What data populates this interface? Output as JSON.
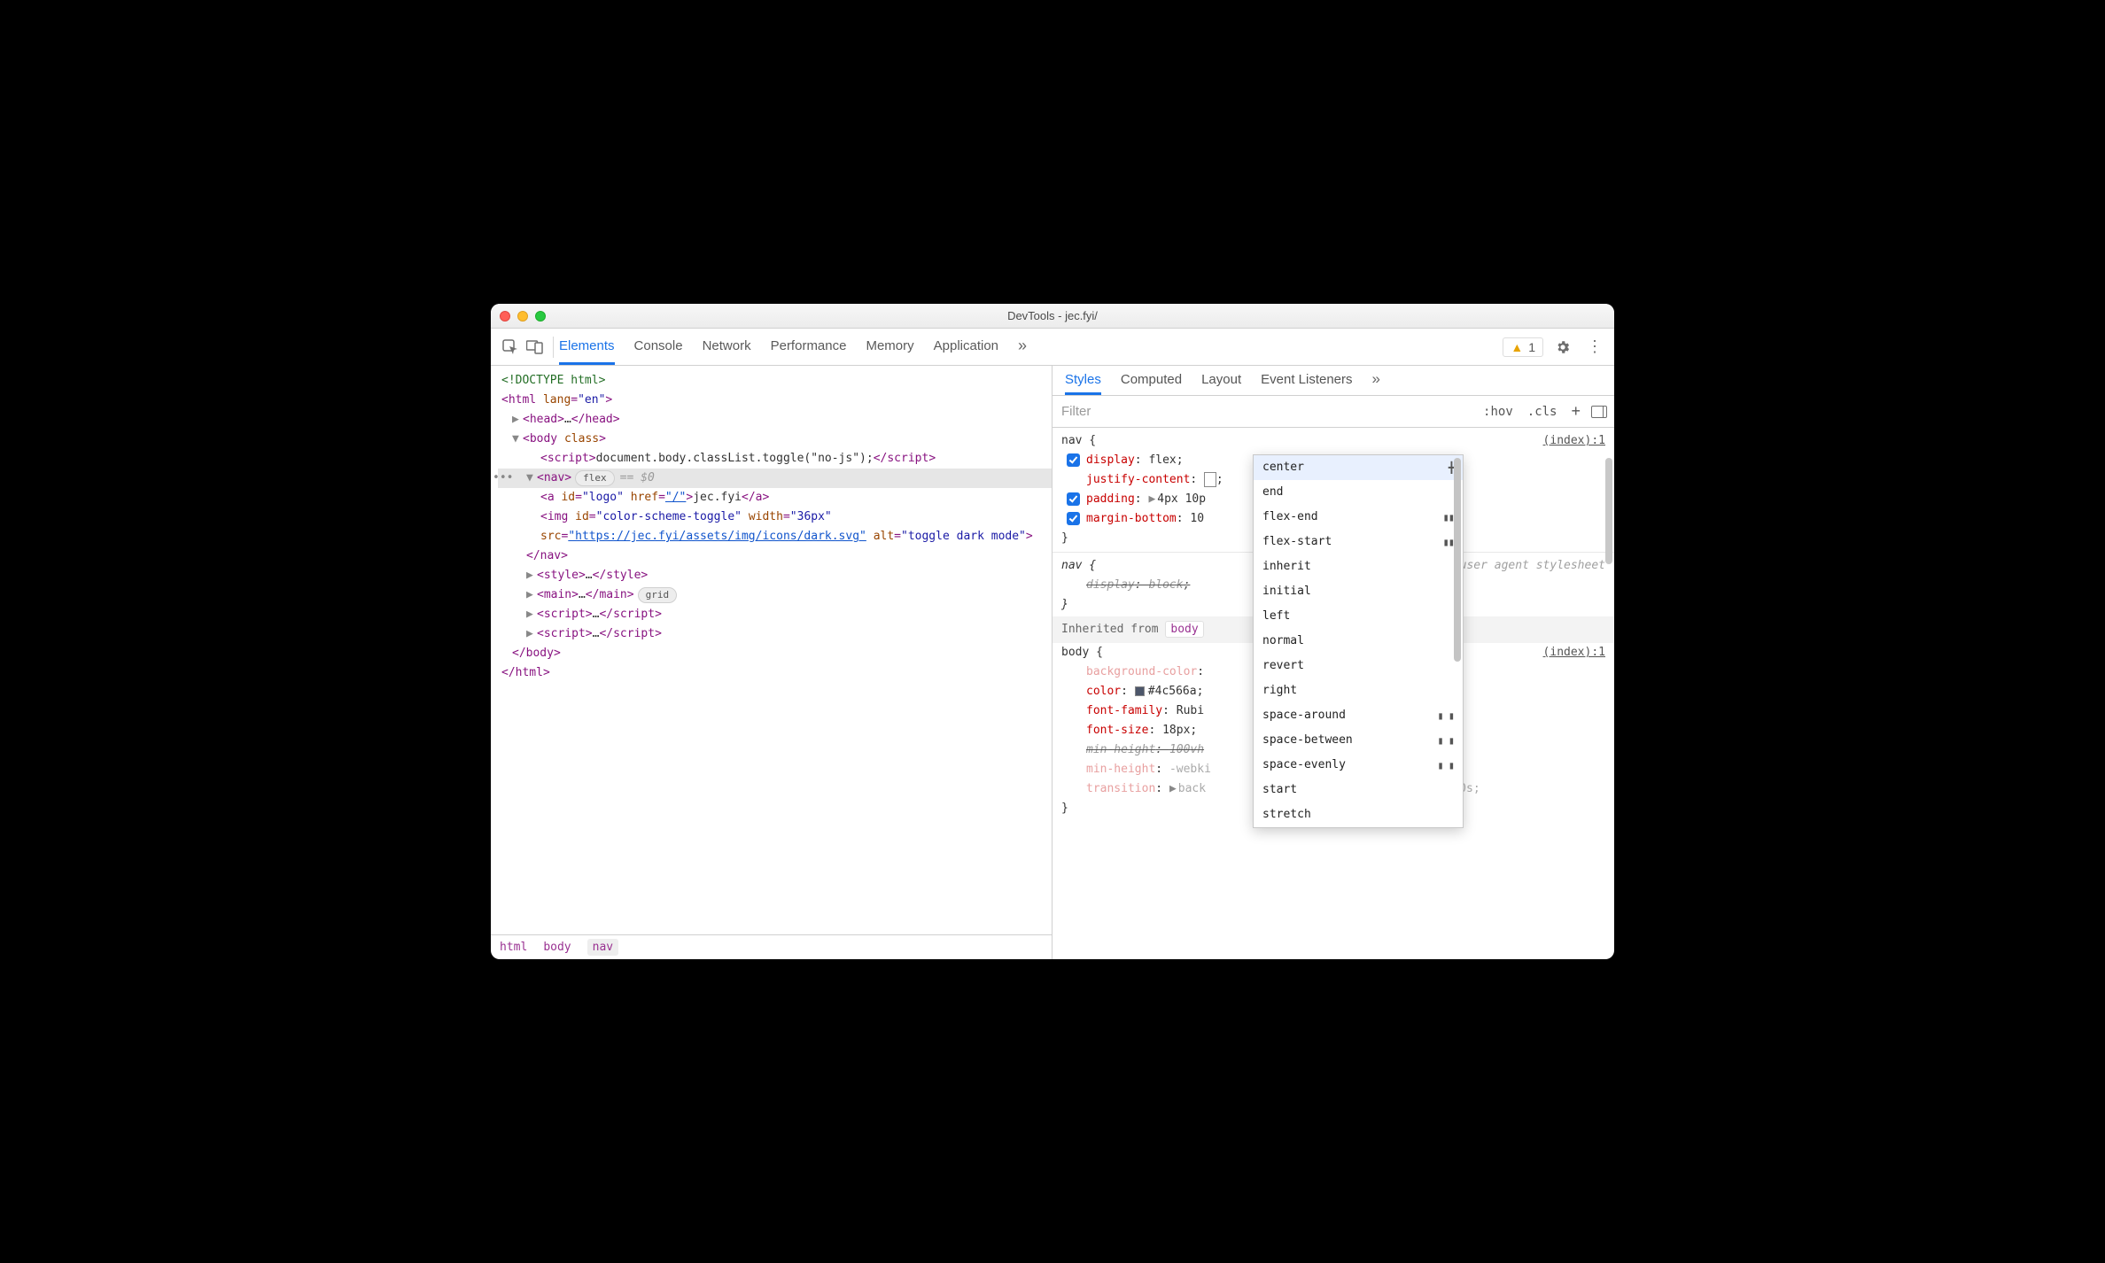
{
  "window_title": "DevTools - jec.fyi/",
  "toolbar": {
    "tabs": [
      "Elements",
      "Console",
      "Network",
      "Performance",
      "Memory",
      "Application"
    ],
    "active_tab": "Elements",
    "overflow_glyph": "»",
    "warning_count": "1"
  },
  "dom": {
    "doctype": "<!DOCTYPE html>",
    "html_open_prefix": "<",
    "html_tag": "html",
    "html_lang_attr": "lang",
    "html_lang_val": "\"en\"",
    "html_open_suffix": ">",
    "head_collapsed": "<head>…</head>",
    "body_open": "<body class>",
    "script_inline_open": "<script>",
    "script_inline_text": "document.body.classList.toggle(\"no-js\");",
    "script_inline_close": "</script>",
    "nav_open": "<nav>",
    "nav_badge": "flex",
    "nav_eq": "== $0",
    "a_open1": "<a ",
    "a_id_attr": "id",
    "a_id_val": "\"logo\"",
    "a_href_attr": "href",
    "a_href_val": "\"/\"",
    "a_open2": ">",
    "a_text": "jec.fyi",
    "a_close": "</a>",
    "img_open": "<img ",
    "img_id_attr": "id",
    "img_id_val": "\"color-scheme-toggle\"",
    "img_width_attr": "width",
    "img_width_val": "\"36px\"",
    "img_src_attr": "src",
    "img_src_val": "\"https://jec.fyi/assets/img/icons/dark.svg\"",
    "img_alt_attr": "alt",
    "img_alt_val": "\"toggle dark mode\"",
    "img_close": ">",
    "nav_close": "</nav>",
    "style_collapsed": "<style>…</style>",
    "main_collapsed": "<main>…</main>",
    "main_badge": "grid",
    "script1_collapsed": "<script>…</script>",
    "script2_collapsed": "<script>…</script>",
    "body_close": "</body>",
    "html_close": "</html>"
  },
  "breadcrumb": {
    "c0": "html",
    "c1": "body",
    "c2": "nav"
  },
  "styles": {
    "tabs": [
      "Styles",
      "Computed",
      "Layout",
      "Event Listeners"
    ],
    "overflow_glyph": "»",
    "filter_placeholder": "Filter",
    "hov": ":hov",
    "cls": ".cls",
    "rules": {
      "r1": {
        "selector": "nav",
        "source": "(index):1",
        "p1": {
          "name": "display",
          "val": "flex"
        },
        "p2": {
          "name": "justify-content",
          "val": ""
        },
        "p3": {
          "name": "padding",
          "val": "4px 10p"
        },
        "p4": {
          "name": "margin-bottom",
          "val": "10"
        }
      },
      "r2": {
        "selector": "nav",
        "ua": "user agent stylesheet",
        "p1": {
          "name": "display",
          "val": "block"
        }
      },
      "inherited_label": "Inherited from",
      "inherited_from": "body",
      "r3": {
        "selector": "body",
        "source": "(index):1",
        "p1": {
          "name": "background-color",
          "val": ""
        },
        "p2": {
          "name": "color",
          "val": "#4c566a"
        },
        "p3": {
          "name": "font-family",
          "val": "Rubi"
        },
        "p4": {
          "name": "font-size",
          "val": "18px"
        },
        "p5": {
          "name": "min-height",
          "val": "100vh"
        },
        "p6": {
          "name": "min-height",
          "val": "-webki"
        },
        "p7": {
          "name": "transition",
          "val": "back"
        },
        "p7_tail": "ase-in-out 0s"
      }
    }
  },
  "autocomplete": {
    "items": [
      {
        "label": "center",
        "glyph": "╋"
      },
      {
        "label": "end",
        "glyph": ""
      },
      {
        "label": "flex-end",
        "glyph": "▮▮"
      },
      {
        "label": "flex-start",
        "glyph": "▮▮"
      },
      {
        "label": "inherit",
        "glyph": ""
      },
      {
        "label": "initial",
        "glyph": ""
      },
      {
        "label": "left",
        "glyph": ""
      },
      {
        "label": "normal",
        "glyph": ""
      },
      {
        "label": "revert",
        "glyph": ""
      },
      {
        "label": "right",
        "glyph": ""
      },
      {
        "label": "space-around",
        "glyph": "▮ ▮"
      },
      {
        "label": "space-between",
        "glyph": "▮  ▮"
      },
      {
        "label": "space-evenly",
        "glyph": "▮ ▮"
      },
      {
        "label": "start",
        "glyph": ""
      },
      {
        "label": "stretch",
        "glyph": ""
      }
    ]
  }
}
